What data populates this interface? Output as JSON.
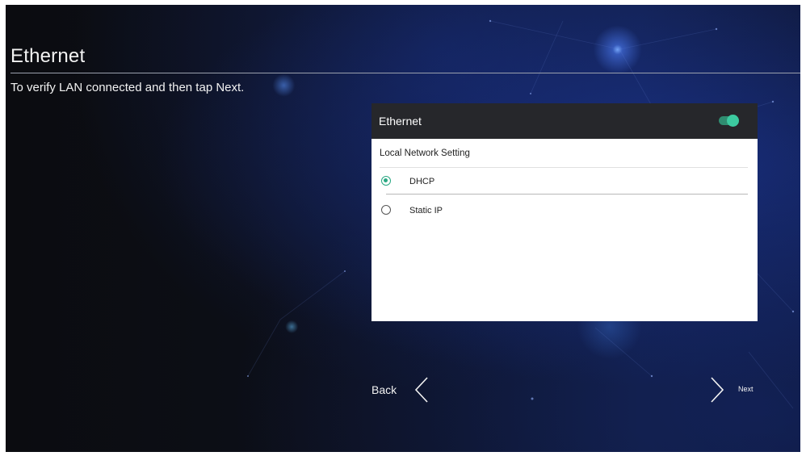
{
  "screen": {
    "title": "Ethernet",
    "instruction": "To verify LAN connected and then tap Next."
  },
  "panel": {
    "title": "Ethernet",
    "toggle": {
      "state": "on",
      "accent_color": "#3ccaa0"
    },
    "section_label": "Local Network Setting",
    "options": [
      {
        "label": "DHCP",
        "selected": true
      },
      {
        "label": "Static IP",
        "selected": false
      }
    ]
  },
  "navigation": {
    "back_label": "Back",
    "next_label": "Next",
    "back_icon": "chevron-left-icon",
    "next_icon": "chevron-right-icon"
  }
}
